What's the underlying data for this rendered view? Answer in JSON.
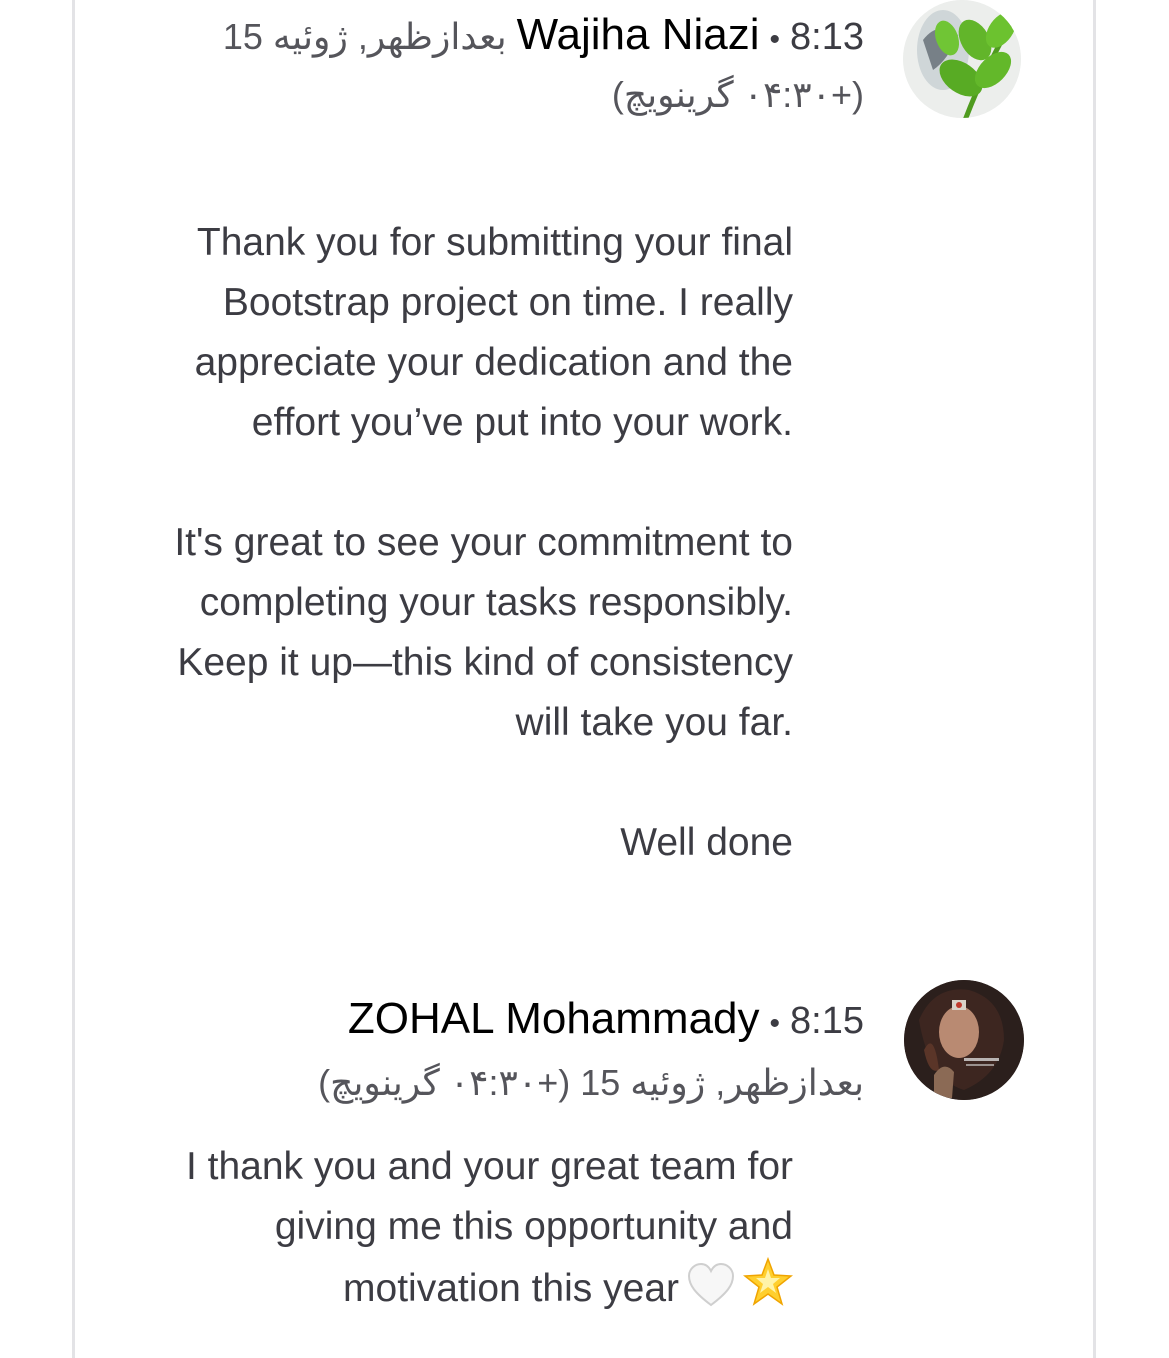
{
  "messages": [
    {
      "sender": "Wajiha Niazi",
      "separator": "•",
      "time": "8:13",
      "date": "بعدازظهر, ژوئیه 15",
      "timezone": "(+۰۴:۳۰ گرینویچ)",
      "avatar_icon": "leaf-branch-avatar",
      "paragraphs": [
        "Thank you for submitting your final Bootstrap project on time. I really appreciate your dedication and the effort you’ve put into your work.",
        "It's great to see your commitment to completing your tasks responsibly. Keep it up—this kind of consistency will take you far.",
        "Well done"
      ]
    },
    {
      "sender": "ZOHAL Mohammady",
      "separator": "•",
      "time": "8:15",
      "date_timezone": "بعدازظهر, ژوئیه 15  (+۰۴:۳۰ گرینویچ)",
      "avatar_icon": "profile-photo-avatar",
      "paragraphs": [
        "I thank you and your great team for giving me this opportunity and motivation this year"
      ],
      "emoji": [
        "white-heart-icon",
        "glowing-star-icon"
      ]
    }
  ],
  "colors": {
    "text": "#3c3c43",
    "name": "#000000",
    "meta": "#55555b",
    "frame_border": "#e3e3e6"
  }
}
